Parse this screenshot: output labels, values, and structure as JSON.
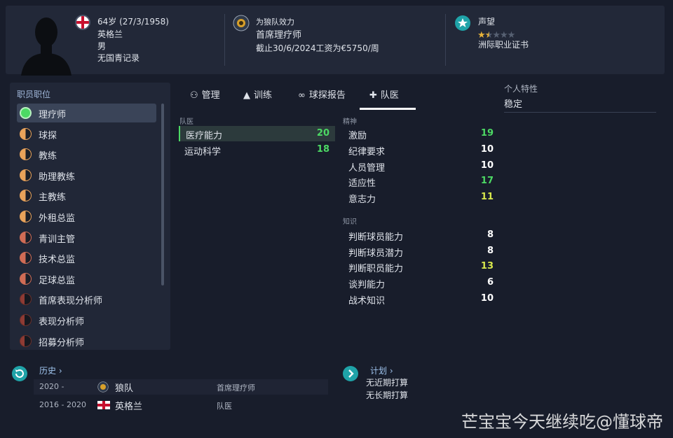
{
  "header": {
    "age_dob": "64岁 (27/3/1958)",
    "nationality": "英格兰",
    "gender": "男",
    "youth_record": "无国青记录",
    "club_label": "为狼队效力",
    "position_title": "首席理疗师",
    "contract": "截止30/6/2024工资为€5750/周",
    "reputation_label": "声望",
    "reputation_stars": 1.5,
    "reputation_max": 5,
    "license": "洲际职业证书"
  },
  "sidebar": {
    "title": "职员职位",
    "items": [
      {
        "label": "理疗师",
        "icon": "green-circle-icon",
        "selected": true
      },
      {
        "label": "球探",
        "icon": "half-orange-circle-icon"
      },
      {
        "label": "教练",
        "icon": "half-orange-circle-icon"
      },
      {
        "label": "助理教练",
        "icon": "half-orange-circle-icon"
      },
      {
        "label": "主教练",
        "icon": "half-orange-circle-icon"
      },
      {
        "label": "外租总监",
        "icon": "half-orange-circle-icon"
      },
      {
        "label": "青训主管",
        "icon": "half-red-circle-icon"
      },
      {
        "label": "技术总监",
        "icon": "half-red-circle-icon"
      },
      {
        "label": "足球总监",
        "icon": "half-red-circle-icon"
      },
      {
        "label": "首席表现分析师",
        "icon": "dark-red-circle-icon"
      },
      {
        "label": "表现分析师",
        "icon": "dark-red-circle-icon"
      },
      {
        "label": "招募分析师",
        "icon": "dark-red-circle-icon"
      }
    ]
  },
  "tabs": [
    {
      "label": "管理",
      "icon": "management-icon"
    },
    {
      "label": "训练",
      "icon": "training-icon"
    },
    {
      "label": "球探报告",
      "icon": "binoculars-icon"
    },
    {
      "label": "队医",
      "icon": "medical-kit-icon",
      "active": true
    }
  ],
  "medical": {
    "heading": "队医",
    "attributes": [
      {
        "label": "医疗能力",
        "value": "20"
      },
      {
        "label": "运动科学",
        "value": "18"
      }
    ]
  },
  "mental": {
    "heading": "精神",
    "attributes": [
      {
        "label": "激励",
        "value": "19"
      },
      {
        "label": "纪律要求",
        "value": "10"
      },
      {
        "label": "人员管理",
        "value": "10"
      },
      {
        "label": "适应性",
        "value": "17"
      },
      {
        "label": "意志力",
        "value": "11"
      }
    ]
  },
  "knowledge": {
    "heading": "知识",
    "attributes": [
      {
        "label": "判断球员能力",
        "value": "8"
      },
      {
        "label": "判断球员潜力",
        "value": "8"
      },
      {
        "label": "判断职员能力",
        "value": "13"
      },
      {
        "label": "谈判能力",
        "value": "6"
      },
      {
        "label": "战术知识",
        "value": "10"
      }
    ]
  },
  "traits": {
    "label": "个人特性",
    "value": "稳定"
  },
  "history": {
    "title": "历史",
    "rows": [
      {
        "years": "2020 -",
        "team": "狼队",
        "role": "首席理疗师"
      },
      {
        "years": "2016 - 2020",
        "team": "英格兰",
        "role": "队医"
      }
    ]
  },
  "plans": {
    "title": "计划",
    "line1": "无近期打算",
    "line2": "无长期打算"
  },
  "watermark": "芒宝宝今天继续吃@懂球帝",
  "colors": {
    "green": "#4cd964",
    "light_green": "#7be36b",
    "yellow": "#d8e84c",
    "white": "#ffffff",
    "accent_teal": "#1fa3a8"
  }
}
